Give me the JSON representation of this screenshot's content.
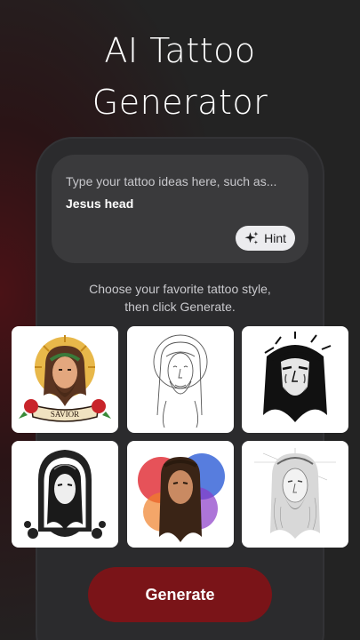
{
  "header": {
    "title_line1": "AI Tattoo",
    "title_line2": "Generator"
  },
  "prompt": {
    "placeholder": "Type your tattoo ideas here, such as...",
    "value": "Jesus head",
    "hint_label": "Hint",
    "hint_icon": "sparkles-icon"
  },
  "styles": {
    "caption_line1": "Choose your favorite tattoo style,",
    "caption_line2": "then click Generate.",
    "items": [
      {
        "style": "traditional",
        "banner_text": "SAVIOR"
      },
      {
        "style": "fine-line"
      },
      {
        "style": "blackwork"
      },
      {
        "style": "ornamental-blackwork"
      },
      {
        "style": "watercolor"
      },
      {
        "style": "sketch"
      }
    ]
  },
  "actions": {
    "generate_label": "Generate"
  },
  "colors": {
    "background": "#242424",
    "card": "#3a3a3c",
    "accent": "#7a1418",
    "hint_bg": "#ececef"
  }
}
